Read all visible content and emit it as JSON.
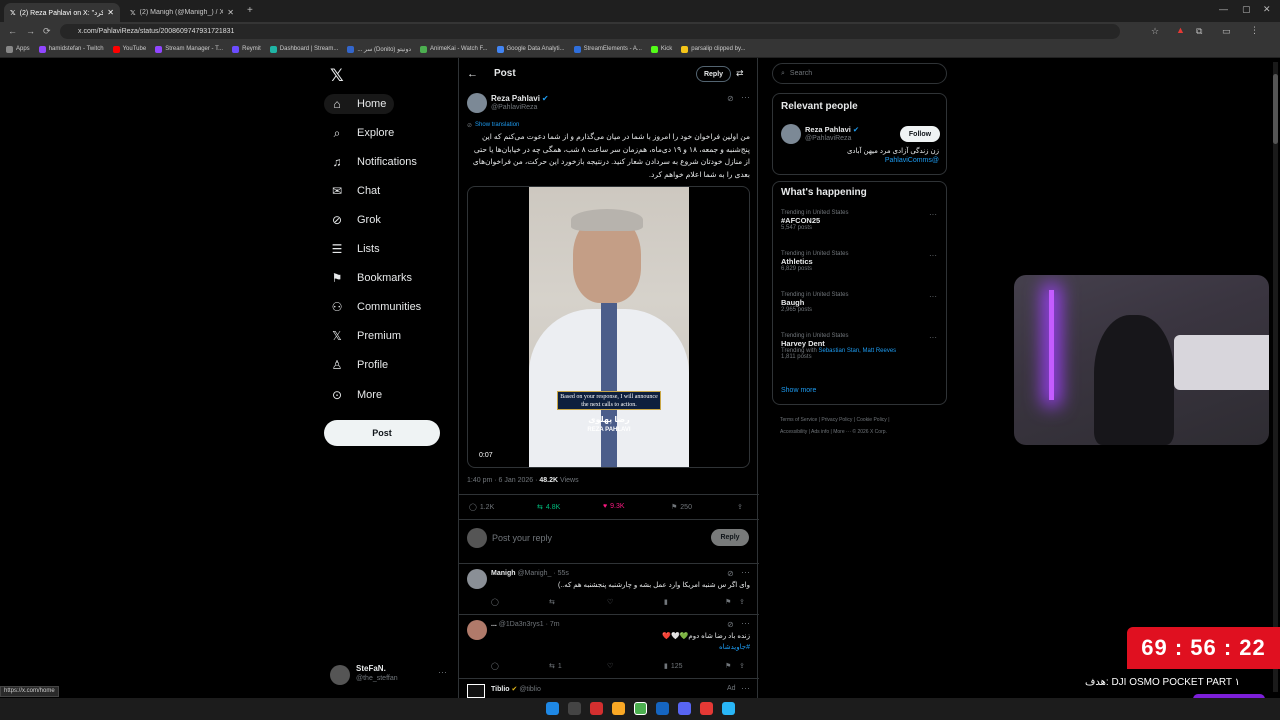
{
  "browser": {
    "tabs": [
      {
        "title": "(2) Reza Pahlavi on X: \"راهم کرد",
        "active": true
      },
      {
        "title": "(2) Manigh (@Manigh_) / X",
        "active": false
      }
    ],
    "url": "x.com/PahlaviReza/status/2008609747931721831",
    "bookmarks": [
      "Apps",
      "hamidstefan - Twitch",
      "YouTube",
      "Stream Manager - T...",
      "Reymit",
      "Dashboard | Stream...",
      "... سر (Donito) دونیتو",
      "AnimeKai - Watch F...",
      "Google Data Analyti...",
      "StreamElements - A...",
      "Kick",
      "parsalip clipped by..."
    ],
    "status_url": "https://x.com/home"
  },
  "nav": {
    "items": [
      "Home",
      "Explore",
      "Notifications",
      "Chat",
      "Grok",
      "Lists",
      "Bookmarks",
      "Communities",
      "Premium",
      "Profile",
      "More"
    ],
    "post_label": "Post",
    "account": {
      "name": "SteFaN.",
      "handle": "@the_steffan"
    }
  },
  "post": {
    "header_title": "Post",
    "reply_label": "Reply",
    "author": {
      "name": "Reza Pahlavi",
      "handle": "@PahlaviReza"
    },
    "show_translation": "Show translation",
    "text": "من اولین فراخوان خود را امروز با شما در میان می‌گذارم و از شما دعوت می‌کنم که این پنج‌شنبه و جمعه، ۱۸ و ۱۹ دی‌ماه، هم‌زمان سر ساعت ۸ شب، همگی چه در خیابان‌ها یا حتی از منازل خودتان شروع به سردادن شعار کنید. درنتیجه بازخورد این حرکت، من فراخوان‌های بعدی را به شما اعلام خواهم کرد.",
    "video": {
      "caption": "Based on your response, I will announce the next calls to action.",
      "watermark_fa": "رضا پهلوی",
      "watermark_en": "REZA PAHLAVI",
      "time": "0:07"
    },
    "meta": {
      "time": "1:40 pm · 6 Jan 2026 · ",
      "views": "48.2K",
      "views_label": " Views"
    },
    "stats": {
      "replies": "1.2K",
      "reposts": "4.8K",
      "likes": "9.3K",
      "bookmarks": "250"
    },
    "compose_placeholder": "Post your reply",
    "compose_button": "Reply"
  },
  "replies": [
    {
      "name": "Manigh",
      "handle": "@Manigh_ · 55s",
      "text": "وای اگر س شنبه امریکا وارد عمل بشه و چارشنبه پنجشنبه هم که..)"
    },
    {
      "name": "...",
      "handle": "@1Da3n3rys1 · 7m",
      "text": "زنده باد رضا شاه دوم💚🤍❤️",
      "hashtag": "#جاویدشاه",
      "reposts": "1",
      "views": "125"
    },
    {
      "name": "Tiblio",
      "handle": "@tiblio",
      "ad": "Ad"
    }
  ],
  "sidebar": {
    "search_placeholder": "Search",
    "relevant_title": "Relevant people",
    "person": {
      "name": "Reza Pahlavi",
      "handle": "@PahlaviReza",
      "follow": "Follow",
      "bio": "زن زندگی آزادی مرد میهن آبادی",
      "bio_link": "@PahlaviComms"
    },
    "happening_title": "What's happening",
    "trends": [
      {
        "meta": "Trending in United States",
        "name": "#AFCON25",
        "posts": "5,547 posts"
      },
      {
        "meta": "Trending in United States",
        "name": "Athletics",
        "posts": "6,829 posts"
      },
      {
        "meta": "Trending in United States",
        "name": "Baugh",
        "posts": "2,965 posts"
      },
      {
        "meta": "Trending in United States",
        "name": "Harvey Dent",
        "with_label": "Trending with ",
        "with": "Sebastian Stan, Matt Reeves",
        "posts": "1,811 posts"
      }
    ],
    "show_more": "Show more",
    "footer": [
      "Terms of Service",
      "Privacy Policy",
      "Cookie Policy",
      "Accessibility",
      "Ads info",
      "More ···",
      "© 2026 X Corp."
    ]
  },
  "overlay": {
    "timer": "69 : 56 : 22",
    "goal": "هدف: DJI OSMO POCKET PART ۱"
  }
}
